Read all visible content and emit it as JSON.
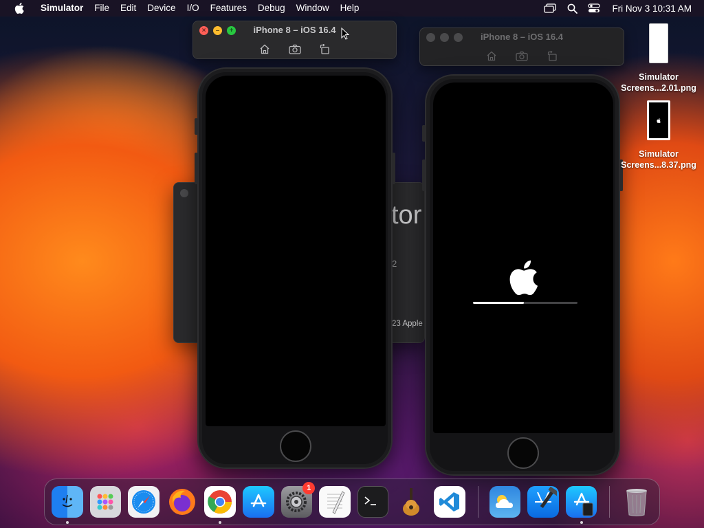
{
  "menubar": {
    "app_name": "Simulator",
    "items": [
      "File",
      "Edit",
      "Device",
      "I/O",
      "Features",
      "Debug",
      "Window",
      "Help"
    ],
    "clock": "Fri Nov 3  10:31 AM",
    "status_icons": [
      "screen-mirroring-icon",
      "search-icon",
      "control-center-icon"
    ]
  },
  "simulator_windows": [
    {
      "title": "iPhone 8 – iOS 16.4",
      "state": "active",
      "tools": [
        "home-icon",
        "screenshot-icon",
        "rotate-icon"
      ]
    },
    {
      "title": "iPhone 8 – iOS 16.4",
      "state": "inactive",
      "tools": [
        "home-icon",
        "screenshot-icon",
        "rotate-icon"
      ]
    }
  ],
  "about_window": {
    "title_fragment": "tor",
    "version_fragment": "2",
    "copyright_fragment": "23 Apple"
  },
  "boot_screen": {
    "logo": "apple-logo-icon",
    "progress": 0.49
  },
  "desktop_files": [
    {
      "label_line1": "Simulator",
      "label_line2": "Screens...2.01.png"
    },
    {
      "label_line1": "Simulator",
      "label_line2": "Screens...8.37.png"
    }
  ],
  "dock": {
    "apps": [
      {
        "name": "Finder",
        "icon": "finder-icon",
        "running": true
      },
      {
        "name": "Launchpad",
        "icon": "launchpad-icon",
        "running": false
      },
      {
        "name": "Safari",
        "icon": "safari-icon",
        "running": false
      },
      {
        "name": "Firefox",
        "icon": "firefox-icon",
        "running": false
      },
      {
        "name": "Google Chrome",
        "icon": "chrome-icon",
        "running": true
      },
      {
        "name": "App Store",
        "icon": "app-store-icon",
        "running": false
      },
      {
        "name": "System Settings",
        "icon": "system-settings-icon",
        "running": false,
        "badge": "1"
      },
      {
        "name": "TextEdit",
        "icon": "textedit-icon",
        "running": false
      },
      {
        "name": "Terminal",
        "icon": "terminal-icon",
        "running": false
      },
      {
        "name": "GarageBand",
        "icon": "garageband-icon",
        "running": false
      },
      {
        "name": "Visual Studio Code",
        "icon": "vscode-icon",
        "running": false
      },
      {
        "name": "Weather",
        "icon": "weather-icon",
        "running": false
      },
      {
        "name": "Xcode",
        "icon": "xcode-icon",
        "running": false
      },
      {
        "name": "Simulator",
        "icon": "simulator-icon",
        "running": true
      },
      {
        "name": "Trash",
        "icon": "trash-icon",
        "running": false
      }
    ],
    "badge_value": "1"
  },
  "colors": {
    "close": "#ff5f57",
    "minimize": "#febc2e",
    "zoom": "#28c840",
    "badge": "#ff3b30"
  }
}
